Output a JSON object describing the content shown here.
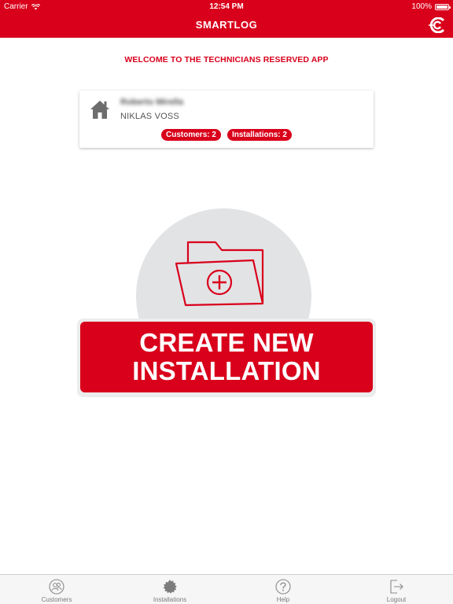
{
  "status_bar": {
    "carrier": "Carrier",
    "time": "12:54 PM",
    "battery": "100%",
    "battery_level": 1.0
  },
  "nav": {
    "title": "SMARTLOG",
    "logo_icon": "brand-logo-icon"
  },
  "welcome_text": "WELCOME TO THE TECHNICIANS RESERVED APP",
  "user_card": {
    "icon": "home-icon",
    "name_blurred": "Roberto Mirella",
    "subname": "NIKLAS VOSS",
    "badges": [
      {
        "label": "Customers:",
        "count": "2"
      },
      {
        "label": "Installations:",
        "count": "2"
      }
    ]
  },
  "hero": {
    "icon": "folder-plus-icon",
    "button_line1": "CREATE NEW",
    "button_line2": "INSTALLATION"
  },
  "tabs": [
    {
      "label": "Customers",
      "icon": "customers-icon"
    },
    {
      "label": "Installations",
      "icon": "installations-icon"
    },
    {
      "label": "Help",
      "icon": "help-icon"
    },
    {
      "label": "Logout",
      "icon": "logout-icon"
    }
  ],
  "colors": {
    "brand_red": "#d9001b",
    "circle_gray": "#e2e3e5",
    "tab_gray": "#7a7a7a"
  }
}
